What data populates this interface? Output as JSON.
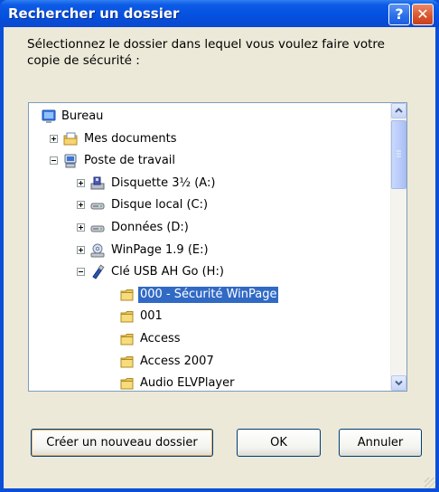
{
  "window": {
    "title": "Rechercher un dossier",
    "help_label": "?",
    "close_label": "✕"
  },
  "prompt": "Sélectionnez le dossier dans lequel vous voulez faire votre copie de sécurité :",
  "tree": {
    "nodes": [
      {
        "label": "Bureau",
        "icon": "desktop-icon",
        "level": 0,
        "expander": "none",
        "selected": false
      },
      {
        "label": "Mes documents",
        "icon": "my-documents-icon",
        "level": 1,
        "expander": "plus",
        "selected": false
      },
      {
        "label": "Poste de travail",
        "icon": "my-computer-icon",
        "level": 1,
        "expander": "minus",
        "selected": false
      },
      {
        "label": "Disquette 3½ (A:)",
        "icon": "floppy-drive-icon",
        "level": 2,
        "expander": "plus",
        "selected": false
      },
      {
        "label": "Disque local (C:)",
        "icon": "hard-drive-icon",
        "level": 2,
        "expander": "plus",
        "selected": false
      },
      {
        "label": "Données (D:)",
        "icon": "hard-drive-icon",
        "level": 2,
        "expander": "plus",
        "selected": false
      },
      {
        "label": "WinPage 1.9 (E:)",
        "icon": "cd-drive-icon",
        "level": 2,
        "expander": "plus",
        "selected": false
      },
      {
        "label": "Clé USB AH Go (H:)",
        "icon": "usb-drive-icon",
        "level": 2,
        "expander": "minus",
        "selected": false
      },
      {
        "label": "000 - Sécurité WinPage",
        "icon": "folder-icon",
        "level": 3,
        "expander": "none",
        "selected": true
      },
      {
        "label": "001",
        "icon": "folder-icon",
        "level": 3,
        "expander": "none",
        "selected": false
      },
      {
        "label": "Access",
        "icon": "folder-icon",
        "level": 3,
        "expander": "none",
        "selected": false
      },
      {
        "label": "Access 2007",
        "icon": "folder-icon",
        "level": 3,
        "expander": "none",
        "selected": false
      },
      {
        "label": "Audio ELVPlayer",
        "icon": "folder-icon",
        "level": 3,
        "expander": "none",
        "selected": false
      }
    ]
  },
  "buttons": {
    "new_folder": "Créer un nouveau dossier",
    "ok": "OK",
    "cancel": "Annuler"
  },
  "colors": {
    "titlebar": "#0451e0",
    "selection": "#316ac5",
    "face": "#ece9d8"
  }
}
